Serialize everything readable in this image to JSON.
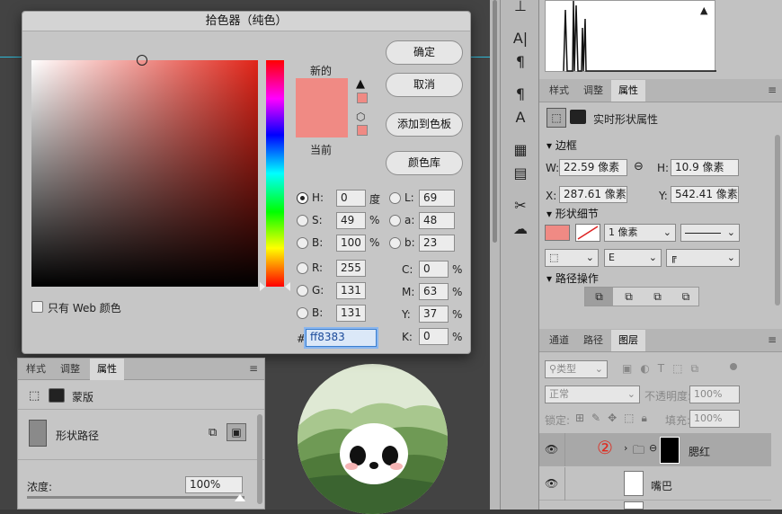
{
  "picker": {
    "title": "拾色器（纯色）",
    "new_label": "新的",
    "current_label": "当前",
    "new_color": "#f08a84",
    "current_color": "#f08a84",
    "buttons": {
      "ok": "确定",
      "cancel": "取消",
      "add_swatch": "添加到色板",
      "libraries": "颜色库"
    },
    "web_only_label": "只有 Web 颜色",
    "fields": {
      "H": {
        "label": "H:",
        "value": "0",
        "unit": "度"
      },
      "S": {
        "label": "S:",
        "value": "49",
        "unit": "%"
      },
      "B": {
        "label": "B:",
        "value": "100",
        "unit": "%"
      },
      "R": {
        "label": "R:",
        "value": "255"
      },
      "G": {
        "label": "G:",
        "value": "131"
      },
      "Bl": {
        "label": "B:",
        "value": "131"
      },
      "L": {
        "label": "L:",
        "value": "69"
      },
      "a": {
        "label": "a:",
        "value": "48"
      },
      "b": {
        "label": "b:",
        "value": "23"
      },
      "C": {
        "label": "C:",
        "value": "0",
        "unit": "%"
      },
      "M": {
        "label": "M:",
        "value": "63",
        "unit": "%"
      },
      "Y": {
        "label": "Y:",
        "value": "37",
        "unit": "%"
      },
      "K": {
        "label": "K:",
        "value": "0",
        "unit": "%"
      }
    },
    "hex_label": "#",
    "hex_value": "ff8383"
  },
  "left_panel": {
    "tabs": [
      "样式",
      "调整",
      "属性"
    ],
    "mask_label": "蒙版",
    "shape_path_label": "形状路径",
    "density_label": "浓度:",
    "density_value": "100%"
  },
  "props_panel": {
    "tabs": [
      "样式",
      "调整",
      "属性"
    ],
    "header": "实时形状属性",
    "bounds_title": "边框",
    "W_label": "W:",
    "W_value": "22.59 像素",
    "H_label": "H:",
    "H_value": "10.9 像素",
    "X_label": "X:",
    "X_value": "287.61 像素",
    "Y_label": "Y:",
    "Y_value": "542.41 像素",
    "shape_detail_title": "形状细节",
    "stroke_width": "1 像素",
    "path_ops_title": "路径操作"
  },
  "layers_panel": {
    "tabs": [
      "通道",
      "路径",
      "图层"
    ],
    "filter_kind": "类型",
    "blend_mode": "正常",
    "opacity_label": "不透明度:",
    "opacity_value": "100%",
    "lock_label": "锁定:",
    "fill_label": "填充:",
    "fill_value": "100%",
    "layers": [
      {
        "name": "腮红",
        "badge": "②"
      },
      {
        "name": "嘴巴"
      }
    ]
  },
  "colors": {
    "accent": "#e02418",
    "selected_row": "#a8a8a8",
    "badge_red": "#e0281c"
  }
}
